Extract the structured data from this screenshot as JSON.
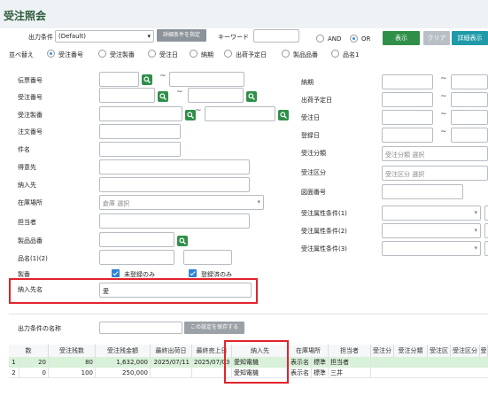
{
  "title": "受注照会",
  "top": {
    "output_label": "出力条件",
    "output_value": "(Default)",
    "detail_btn": "詳細条件を指定",
    "keyword_label": "キーワード",
    "and_label": "AND",
    "or_label": "OR",
    "show_btn": "表示",
    "clear_btn": "クリア",
    "detail_show_btn": "詳細表示"
  },
  "sort": {
    "label": "並べ替え",
    "options": [
      "受注番号",
      "受注製番",
      "受注日",
      "納期",
      "出荷予定日",
      "製品品番",
      "品名1"
    ]
  },
  "left_fields": {
    "slip_no": "伝票番号",
    "order_no": "受注番号",
    "order_seiban": "受注製番",
    "po_no": "注文番号",
    "subject": "件名",
    "customer": "得意先",
    "delivery": "納入先",
    "warehouse": "在庫場所",
    "warehouse_placeholder": "倉庫 選択",
    "person": "担当者",
    "product_code": "製品品番",
    "product_name": "品名(1)(2)",
    "seiban": "製番",
    "unregistered_only": "未登録のみ",
    "registered_only": "登録済のみ",
    "delivery_name": "納入先名",
    "delivery_name_value": "愛",
    "output_name": "出力条件の名称",
    "save_btn": "この設定を保存する"
  },
  "right_fields": {
    "due": "納期",
    "ship_plan": "出荷予定日",
    "order_date": "受注日",
    "reg_date": "登録日",
    "order_class": "受注分類",
    "order_class_ph": "受注分類 選択",
    "order_div": "受注区分",
    "order_div_ph": "受注区分 選択",
    "drawing_no": "図面番号",
    "attr1": "受注属性条件(1)",
    "attr2": "受注属性条件(2)",
    "attr3": "受注属性条件(3)"
  },
  "grid": {
    "headers": [
      "数",
      "受注残数",
      "受注残金額",
      "最終出荷日",
      "最終売上日",
      "納入先",
      "在庫場所",
      "担当者",
      "受注分",
      "受注分類",
      "受注区",
      "受注区分",
      "受"
    ],
    "rows": [
      {
        "idx": "1",
        "qty": "20",
        "remain": "80",
        "amount": "1,632,000",
        "ship": "2025/07/11",
        "sales": "2025/07/03",
        "dest": "愛知電機",
        "wh": "表示名",
        "wh2": "標準",
        "person": "担当者"
      },
      {
        "idx": "2",
        "qty": "0",
        "remain": "100",
        "amount": "250,000",
        "ship": "",
        "sales": "",
        "dest": "愛知電機",
        "wh": "表示名",
        "wh2": "標準",
        "person": "三井"
      }
    ]
  },
  "colors": {
    "accent_green": "#2f8f49",
    "highlight_red": "#e0242d",
    "radio_blue": "#3a8dd8"
  }
}
